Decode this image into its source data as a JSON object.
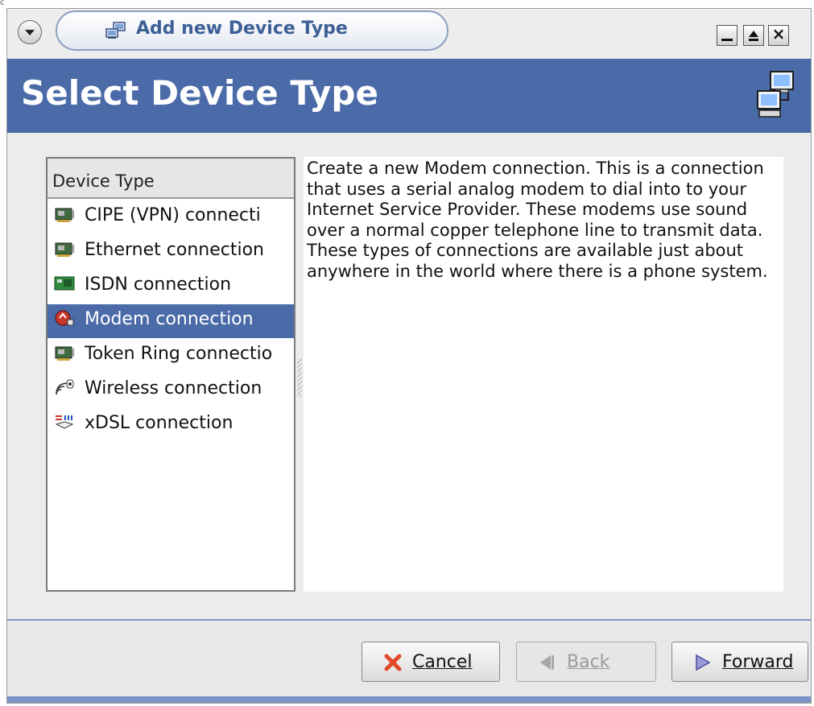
{
  "corner": {
    "text": "c"
  },
  "window": {
    "title": "Add new Device Type",
    "title_icon": "network-computers-icon",
    "controls": [
      "minimize",
      "maximize",
      "close"
    ]
  },
  "header": {
    "title": "Select Device Type",
    "icon": "network-computers-icon"
  },
  "device_list": {
    "column_header": "Device Type",
    "items": [
      {
        "label": "CIPE (VPN) connecti",
        "icon": "network-card-icon",
        "selected": false
      },
      {
        "label": "Ethernet connection",
        "icon": "network-card-icon",
        "selected": false
      },
      {
        "label": "ISDN connection",
        "icon": "isdn-card-icon",
        "selected": false
      },
      {
        "label": "Modem connection",
        "icon": "modem-icon",
        "selected": true
      },
      {
        "label": "Token Ring connectio",
        "icon": "network-card-icon",
        "selected": false
      },
      {
        "label": "Wireless connection",
        "icon": "wireless-icon",
        "selected": false
      },
      {
        "label": "xDSL connection",
        "icon": "xdsl-icon",
        "selected": false
      }
    ]
  },
  "description": {
    "text": "Create a new Modem connection.  This is a connection that uses a serial analog modem to dial into to your Internet Service Provider. These modems use sound over a normal copper telephone line to transmit data.  These types of connections are available just about anywhere in the world where there is a phone system."
  },
  "buttons": {
    "cancel": {
      "label": "Cancel",
      "icon": "cancel-x-icon",
      "enabled": true
    },
    "back": {
      "label": "Back",
      "icon": "back-arrow-icon",
      "enabled": false
    },
    "forward": {
      "label": "Forward",
      "icon": "forward-arrow-icon",
      "enabled": true
    }
  },
  "colors": {
    "accent": "#4a6aa8",
    "title_text": "#3d5f96",
    "cancel_icon": "#e0482a",
    "disabled_text": "#9a9a9a"
  }
}
